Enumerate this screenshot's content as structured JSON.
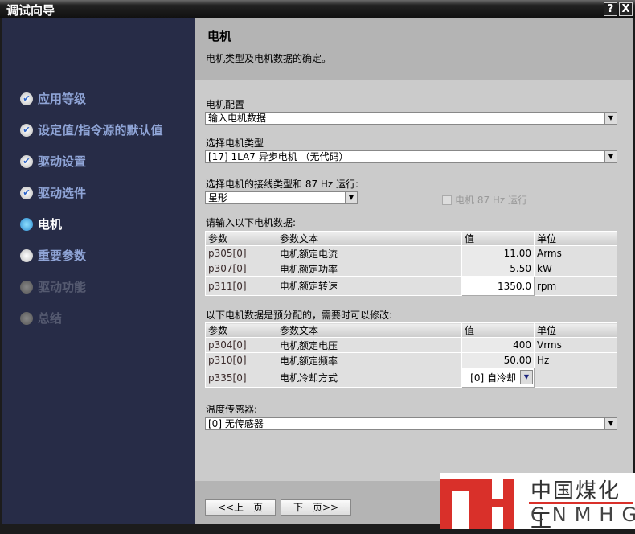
{
  "window": {
    "title": "调试向导",
    "help": "?",
    "close": "X"
  },
  "sidebar": {
    "items": [
      {
        "label": "应用等级",
        "state": "done"
      },
      {
        "label": "设定值/指令源的默认值",
        "state": "done"
      },
      {
        "label": "驱动设置",
        "state": "done"
      },
      {
        "label": "驱动选件",
        "state": "done"
      },
      {
        "label": "电机",
        "state": "current"
      },
      {
        "label": "重要参数",
        "state": "pending"
      },
      {
        "label": "驱动功能",
        "state": "disabled"
      },
      {
        "label": "总结",
        "state": "disabled"
      }
    ]
  },
  "header": {
    "title": "电机",
    "subtitle": "电机类型及电机数据的确定。"
  },
  "form": {
    "motor_config_label": "电机配置",
    "motor_config_value": "输入电机数据",
    "motor_type_label": "选择电机类型",
    "motor_type_value": "[17] 1LA7 异步电机 （无代码）",
    "wiring_label": "选择电机的接线类型和 87 Hz 运行:",
    "wiring_value": "星形",
    "hz87_label": "电机 87 Hz 运行",
    "hz87_checked": false,
    "table1_label": "请输入以下电机数据:",
    "table2_label": "以下电机数据是预分配的，需要时可以修改:",
    "headers": [
      "参数",
      "参数文本",
      "值",
      "单位"
    ],
    "table1": [
      [
        "p305[0]",
        "电机额定电流",
        "11.00",
        "Arms"
      ],
      [
        "p307[0]",
        "电机额定功率",
        "5.50",
        "kW"
      ],
      [
        "p311[0]",
        "电机额定转速",
        "1350.0",
        "rpm"
      ]
    ],
    "table2": [
      [
        "p304[0]",
        "电机额定电压",
        "400",
        "Vrms"
      ],
      [
        "p310[0]",
        "电机额定频率",
        "50.00",
        "Hz"
      ],
      [
        "p335[0]",
        "电机冷却方式",
        "[0] 自冷却",
        ""
      ]
    ],
    "temp_sensor_label": "温度传感器:",
    "temp_sensor_value": "[0] 无传感器"
  },
  "footer": {
    "prev": "<<上一页",
    "next": "下一页>>"
  },
  "watermark": {
    "cn": "中国煤化工",
    "en": "CNMHG",
    "logo": "MH"
  }
}
